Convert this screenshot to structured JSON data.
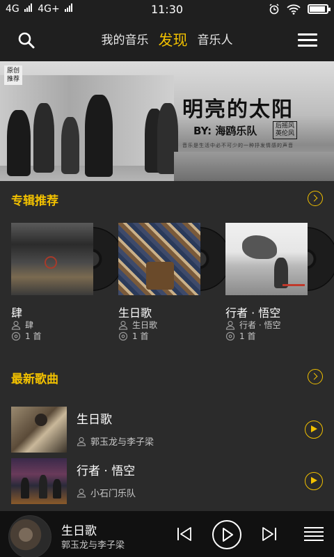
{
  "status_bar": {
    "carrier1": "4G",
    "carrier2": "4G+",
    "time": "11:30",
    "battery_level": 0.9
  },
  "header": {
    "tabs": [
      {
        "label": "我的音乐",
        "active": false
      },
      {
        "label": "发现",
        "active": true
      },
      {
        "label": "音乐人",
        "active": false
      }
    ]
  },
  "banner": {
    "tag_line1": "原创",
    "tag_line2": "推荐",
    "title": "明亮的太阳",
    "by_label": "BY:",
    "band": "海鸥乐队",
    "genre_line1": "后摇风",
    "genre_line2": "英伦风",
    "slogan": "音乐是生活中必不可少的一种抒发情感的声音"
  },
  "album_section": {
    "title": "专辑推荐",
    "albums": [
      {
        "name": "肆",
        "artist": "肆",
        "count": "1 首"
      },
      {
        "name": "生日歌",
        "artist": "生日歌",
        "count": "1 首"
      },
      {
        "name": "行者 · 悟空",
        "artist": "行者 · 悟空",
        "count": "1 首"
      }
    ]
  },
  "song_section": {
    "title": "最新歌曲",
    "songs": [
      {
        "title": "生日歌",
        "artist": "郭玉龙与李子梁"
      },
      {
        "title": "行者 · 悟空",
        "artist": "小石门乐队"
      }
    ]
  },
  "player": {
    "title": "生日歌",
    "artist": "郭玉龙与李子梁"
  },
  "colors": {
    "accent": "#f2c100",
    "background": "#2b2b2b",
    "bar": "#1f1f1f"
  }
}
